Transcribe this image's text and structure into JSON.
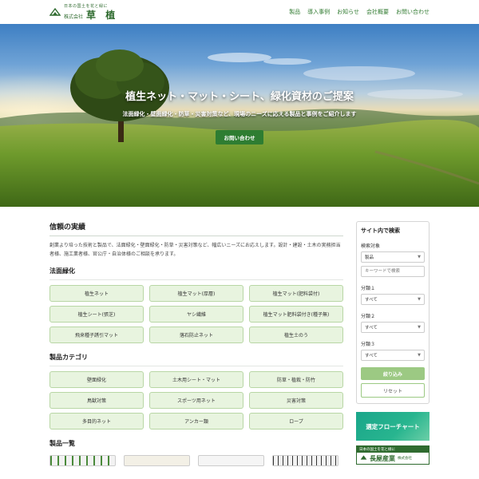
{
  "header": {
    "logo_tagline": "日本の国土を花と緑に",
    "logo_corp": "株式会社",
    "logo_name": "草 植",
    "nav": [
      "製品",
      "導入事例",
      "お知らせ",
      "会社概要",
      "お問い合わせ"
    ]
  },
  "hero": {
    "title": "植生ネット・マット・シート、緑化資材のご提案",
    "subtitle": "法面緑化・壁面緑化・防草・災害対策など、現場のニーズに応える製品と事例をご紹介します",
    "cta_label": "お問い合わせ"
  },
  "main": {
    "section_title": "信頼の実績",
    "intro": "創業より培った技術と製品で、法面緑化・壁面緑化・防草・災害対策など、幅広いニーズにお応えします。設計・建設・土木の実務担当者様、施工業者様、官公庁・自治体様のご相談を承ります。",
    "slope": {
      "title": "法面緑化",
      "items": [
        "植生ネット",
        "植生マット(厚層)",
        "植生マット(肥料袋付)",
        "植生シート(張芝)",
        "ヤシ繊維",
        "植生マット肥料袋付き(種子無)",
        "飛来種子誘引マット",
        "落石防止ネット",
        "植生土のう"
      ]
    },
    "categories": {
      "title": "製品カテゴリ",
      "items": [
        "壁面緑化",
        "土木用シート・マット",
        "防草・植栽・防竹",
        "鳥獣対策",
        "スポーツ用ネット",
        "災害対策",
        "多目的ネット",
        "アンカー類",
        "ロープ"
      ]
    },
    "products_title": "製品一覧"
  },
  "sidebar": {
    "search_title": "サイト内で検索",
    "target_label": "検索対象",
    "target_value": "製品",
    "keyword_placeholder": "キーワードで検索",
    "cat1_label": "分類１",
    "cat2_label": "分類２",
    "cat3_label": "分類３",
    "all_value": "すべて",
    "filter_label": "絞り込み",
    "reset_label": "リセット",
    "banner_flow": "選定フローチャート",
    "banner_co_top": "日本の国土を花と緑に",
    "banner_co_name": "長屋産業",
    "banner_co_corp": "株式会社"
  },
  "colors": {
    "brand_green": "#2f6b2f",
    "tile_bg": "#e8f4df",
    "tile_border": "#b8d6a5",
    "cta": "#2e7d32",
    "filter_btn": "#9cc983",
    "banner_teal": "#1aa68a"
  }
}
